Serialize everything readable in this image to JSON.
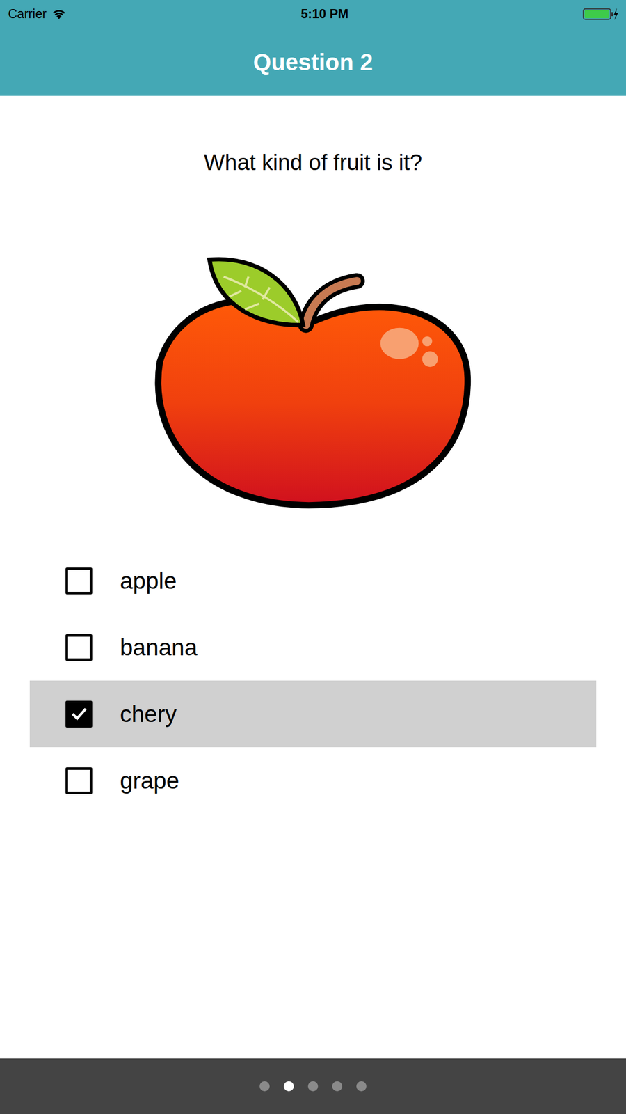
{
  "status_bar": {
    "carrier": "Carrier",
    "time": "5:10 PM"
  },
  "header": {
    "title": "Question 2"
  },
  "question": "What kind of fruit is it?",
  "options": [
    {
      "label": "apple",
      "checked": false
    },
    {
      "label": "banana",
      "checked": false
    },
    {
      "label": "chery",
      "checked": true
    },
    {
      "label": "grape",
      "checked": false
    }
  ],
  "page_indicator": [
    {
      "selected": false
    },
    {
      "selected": true
    },
    {
      "selected": false
    },
    {
      "selected": false
    },
    {
      "selected": false
    }
  ]
}
